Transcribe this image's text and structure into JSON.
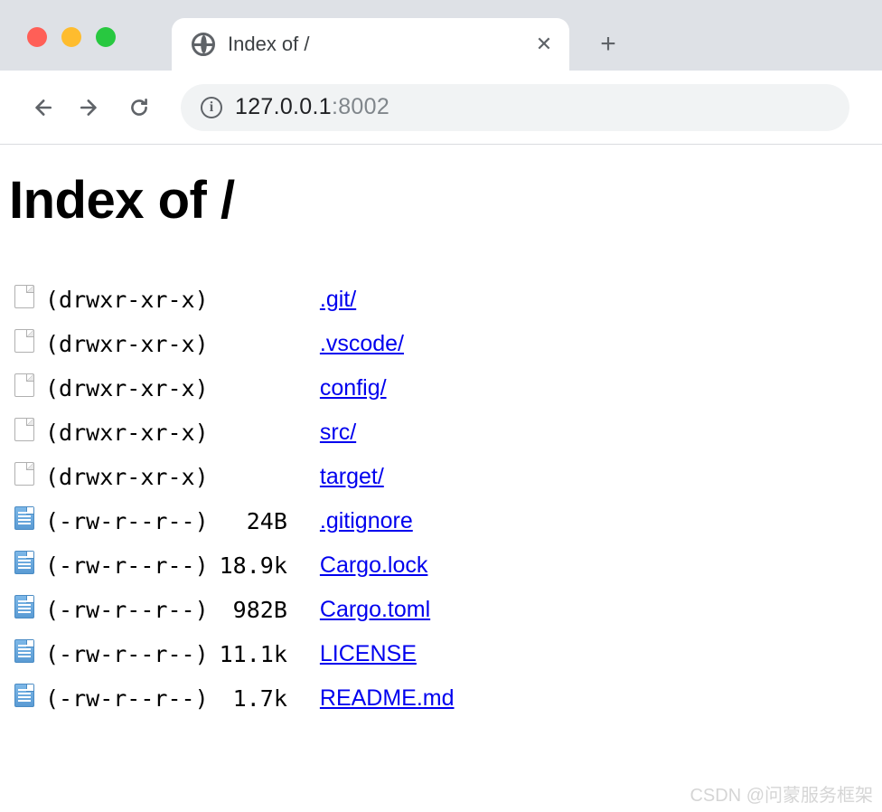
{
  "browser": {
    "tab_title": "Index of /",
    "address_host": "127.0.0.1",
    "address_port": ":8002"
  },
  "page": {
    "heading": "Index of /"
  },
  "listing": [
    {
      "type": "dir",
      "perms": "(drwxr-xr-x)",
      "size": "",
      "name": ".git/"
    },
    {
      "type": "dir",
      "perms": "(drwxr-xr-x)",
      "size": "",
      "name": ".vscode/"
    },
    {
      "type": "dir",
      "perms": "(drwxr-xr-x)",
      "size": "",
      "name": "config/"
    },
    {
      "type": "dir",
      "perms": "(drwxr-xr-x)",
      "size": "",
      "name": "src/"
    },
    {
      "type": "dir",
      "perms": "(drwxr-xr-x)",
      "size": "",
      "name": "target/"
    },
    {
      "type": "file",
      "perms": "(-rw-r--r--)",
      "size": "24B",
      "name": ".gitignore"
    },
    {
      "type": "file",
      "perms": "(-rw-r--r--)",
      "size": "18.9k",
      "name": "Cargo.lock"
    },
    {
      "type": "file",
      "perms": "(-rw-r--r--)",
      "size": "982B",
      "name": "Cargo.toml"
    },
    {
      "type": "file",
      "perms": "(-rw-r--r--)",
      "size": "11.1k",
      "name": "LICENSE"
    },
    {
      "type": "file",
      "perms": "(-rw-r--r--)",
      "size": "1.7k",
      "name": "README.md"
    }
  ],
  "watermark": "CSDN @问蒙服务框架"
}
